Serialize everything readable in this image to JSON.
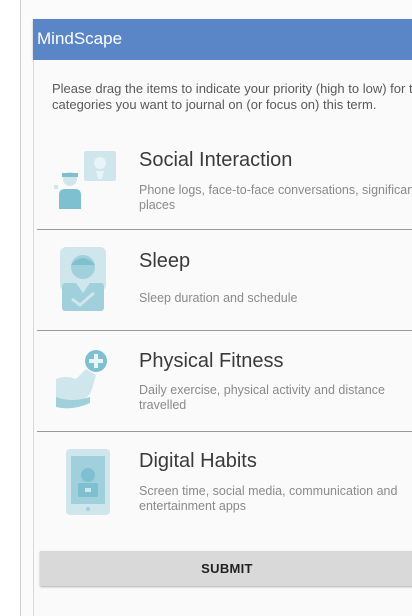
{
  "app": {
    "title": "MindScape"
  },
  "instructions": "Please drag the items to indicate your priority (high to low) for the categories you want to journal on (or focus on) this term.",
  "items": [
    {
      "name": "Social Interaction",
      "description": "Phone logs, face-to-face conversations, significant places",
      "icon": "social-interaction-icon"
    },
    {
      "name": "Sleep",
      "description": "Sleep duration and schedule",
      "icon": "sleep-icon"
    },
    {
      "name": "Physical Fitness",
      "description": "Daily exercise, physical activity and distance travelled",
      "icon": "physical-fitness-icon"
    },
    {
      "name": "Digital Habits",
      "description": "Screen time, social media, communication and entertainment apps",
      "icon": "digital-habits-icon"
    }
  ],
  "submit_label": "SUBMIT",
  "colors": {
    "appbar": "#5a86c8",
    "icon_light": "#cfe6ec",
    "icon_dark": "#7ec0cf"
  }
}
